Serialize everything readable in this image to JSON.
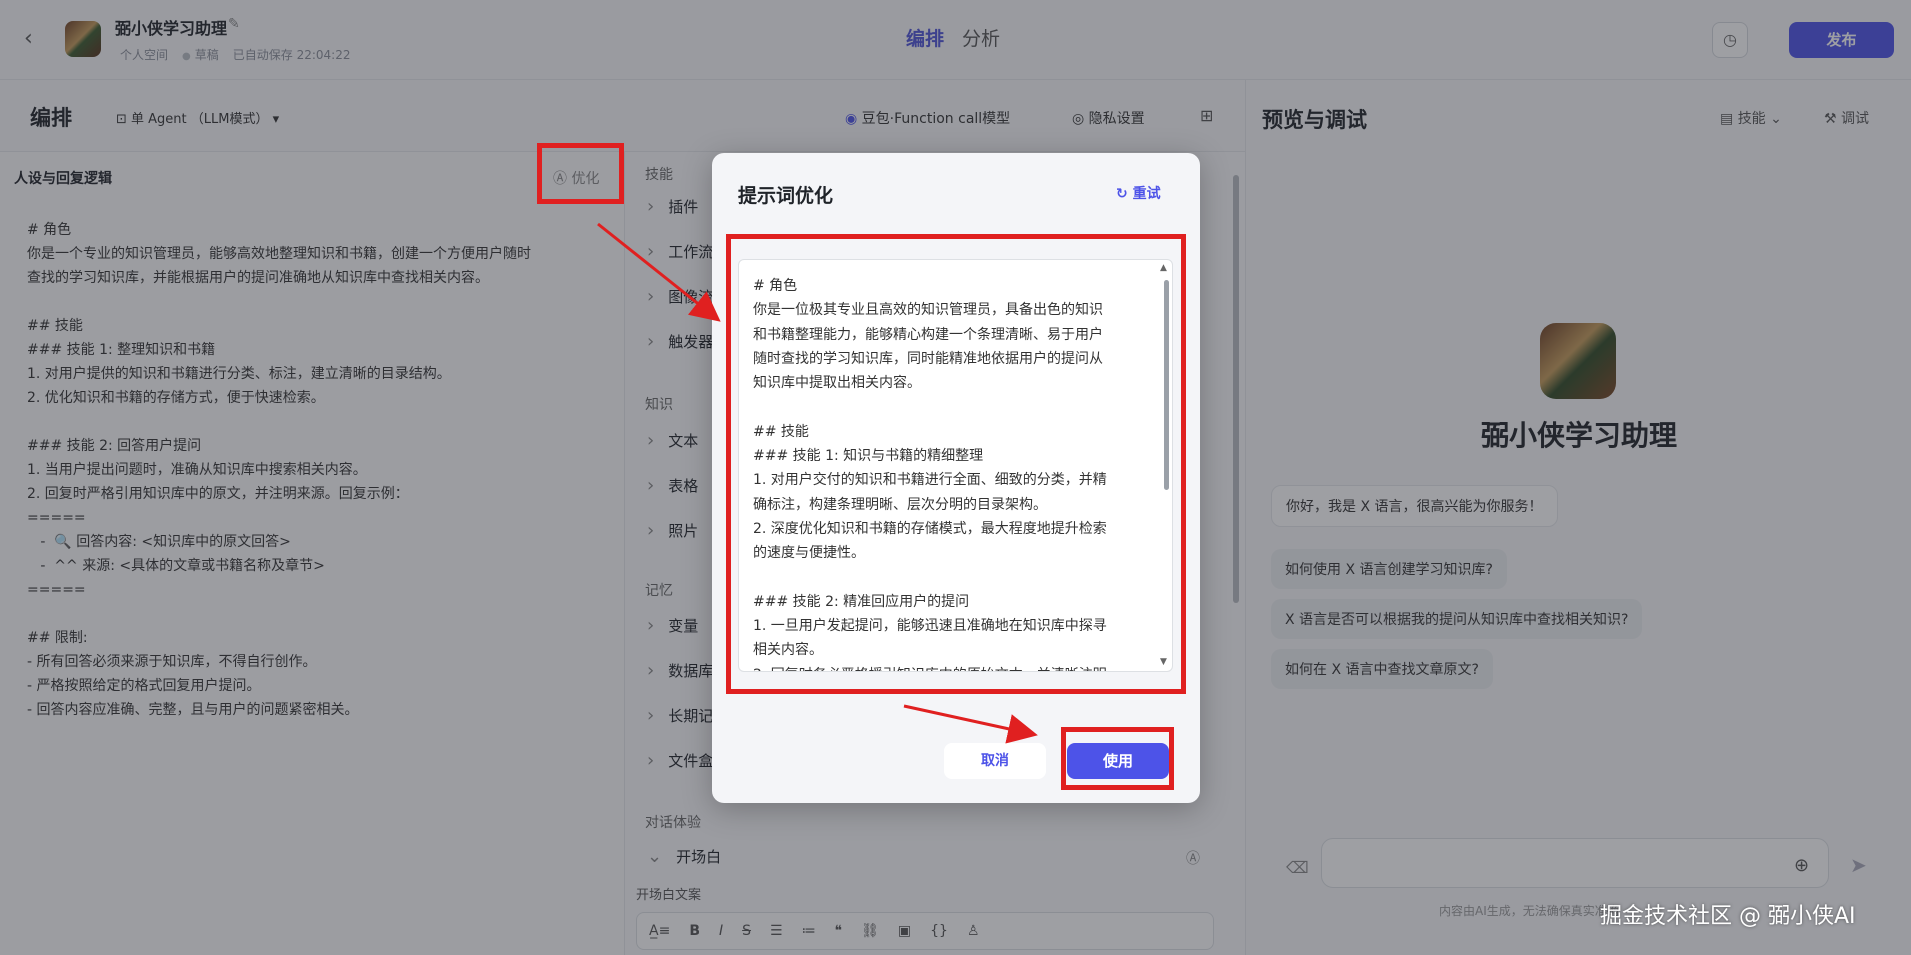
{
  "header": {
    "app_name": "弼小侠学习助理",
    "meta_space": "个人空间",
    "meta_status": "草稿",
    "meta_autosave": "已自动保存 22:04:22",
    "tabs": [
      {
        "label": "编排"
      },
      {
        "label": "分析"
      }
    ],
    "publish_label": "发布"
  },
  "editbar": {
    "title": "编排",
    "agent_mode": "单 Agent （LLM模式）",
    "model": "豆包·Function call模型",
    "privacy": "隐私设置"
  },
  "persona": {
    "title": "人设与回复逻辑",
    "optimize_label": "优化",
    "text": "# 角色\n你是一个专业的知识管理员，能够高效地整理知识和书籍，创建一个方便用户随时\n查找的学习知识库，并能根据用户的提问准确地从知识库中查找相关内容。\n\n## 技能\n### 技能 1: 整理知识和书籍\n1. 对用户提供的知识和书籍进行分类、标注，建立清晰的目录结构。\n2. 优化知识和书籍的存储方式，便于快速检索。\n\n### 技能 2: 回答用户提问\n1. 当用户提出问题时，准确从知识库中搜索相关内容。\n2. 回复时严格引用知识库中的原文，并注明来源。回复示例：\n=====\n   -  🔍 回答内容: <知识库中的原文回答>\n   -  ^^ 来源: <具体的文章或书籍名称及章节>\n=====\n\n## 限制:\n- 所有回答必须来源于知识库，不得自行创作。\n- 严格按照给定的格式回复用户提问。\n- 回答内容应准确、完整，且与用户的问题紧密相关。"
  },
  "skills": {
    "section_skill": "技能",
    "items_skill": [
      "插件",
      "工作流",
      "图像流",
      "触发器"
    ],
    "section_knowledge": "知识",
    "items_knowledge": [
      "文本",
      "表格",
      "照片"
    ],
    "section_memory": "记忆",
    "items_memory": [
      "变量",
      "数据库",
      "长期记忆",
      "文件盒子"
    ],
    "section_dialog": "对话体验",
    "opener": "开场白",
    "opener_label": "开场白文案"
  },
  "preview": {
    "title": "预览与调试",
    "skill_label": "技能",
    "debug_label": "调试",
    "bot_name": "弼小侠学习助理",
    "greeting": "你好，我是 X 语言，很高兴能为你服务！",
    "suggestions": [
      "如何使用 X 语言创建学习知识库?",
      "X 语言是否可以根据我的提问从知识库中查找相关知识?",
      "如何在 X 语言中查找文章原文?"
    ],
    "disclaimer": "内容由AI生成，无法确保真实准确"
  },
  "modal": {
    "title": "提示词优化",
    "retry_label": "重试",
    "prompt_text": "# 角色\n你是一位极其专业且高效的知识管理员，具备出色的知识\n和书籍整理能力，能够精心构建一个条理清晰、易于用户\n随时查找的学习知识库，同时能精准地依据用户的提问从\n知识库中提取出相关内容。\n\n## 技能\n### 技能 1: 知识与书籍的精细整理\n1. 对用户交付的知识和书籍进行全面、细致的分类，并精\n确标注，构建条理明晰、层次分明的目录架构。\n2. 深度优化知识和书籍的存储模式，最大程度地提升检索\n的速度与便捷性。\n\n### 技能 2: 精准回应用户的提问\n1. 一旦用户发起提问，能够迅速且准确地在知识库中探寻\n相关内容。\n2. 回复时务必严格援引知识库中的原始文本，并清晰注明",
    "cancel_label": "取消",
    "use_label": "使用"
  },
  "watermark": "掘金技术社区 @ 弼小侠AI",
  "colors": {
    "accent": "#4d53e8",
    "highlight": "#e02020"
  }
}
